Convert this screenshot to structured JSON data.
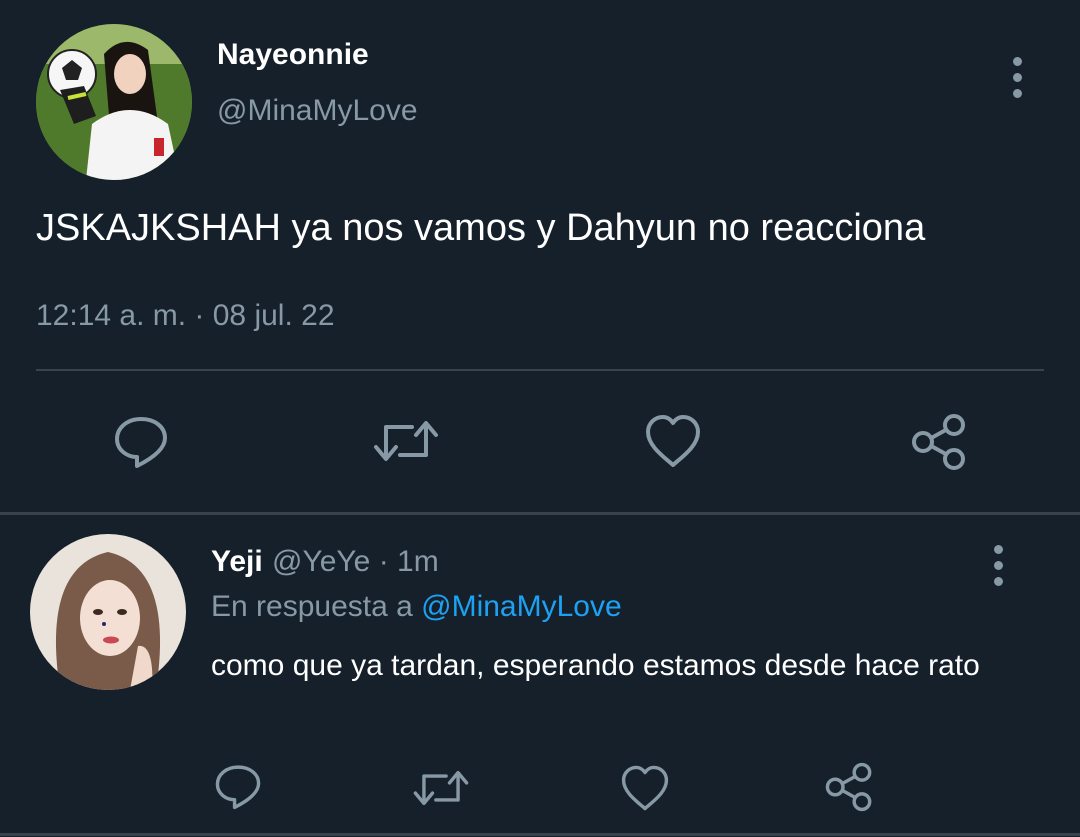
{
  "main_tweet": {
    "author_name": "Nayeonnie",
    "author_handle": "@MinaMyLove",
    "text": "JSKAJKSHAH ya nos vamos y Dahyun no reacciona",
    "timestamp": "12:14 a. m. · 08 jul. 22",
    "actions": [
      "comment-icon",
      "retweet-icon",
      "heart-icon",
      "share-icon"
    ]
  },
  "reply_tweet": {
    "author_name": "Yeji",
    "author_handle": "@YeYe",
    "time_sep": "·",
    "time_ago": "1m",
    "replying_prefix": "En respuesta a",
    "replying_mention": "@MinaMyLove",
    "text": "como que ya tardan, esperando estamos desde hace rato",
    "actions": [
      "comment-icon",
      "retweet-icon",
      "heart-icon",
      "share-icon"
    ]
  },
  "colors": {
    "background": "#15202b",
    "text_primary": "#ffffff",
    "text_secondary": "#8899a6",
    "accent": "#1da1f2",
    "divider": "#38444d"
  }
}
